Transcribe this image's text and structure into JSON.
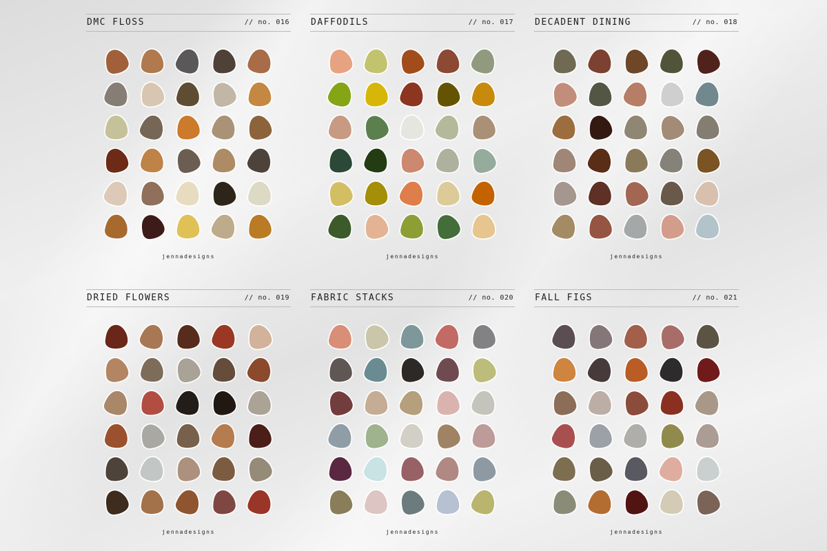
{
  "brand": "jennadesigns",
  "palettes": [
    {
      "title": "DMC FLOSS",
      "number": "// no. 016",
      "rows": [
        [
          "#a1603a",
          "#b07a4e",
          "#5a5859",
          "#4f4038",
          "#a86c48"
        ],
        [
          "#867d74",
          "#d8c6b3",
          "#5e4c33",
          "#c2b7a6",
          "#c48843"
        ],
        [
          "#c5c19a",
          "#766655",
          "#cc7a2b",
          "#a99276",
          "#8d633c"
        ],
        [
          "#6d2a16",
          "#bf8347",
          "#6b5d51",
          "#ad8c65",
          "#4e433b"
        ],
        [
          "#dcc9b7",
          "#90705a",
          "#e7dcc0",
          "#2e251a",
          "#dcd9c5"
        ],
        [
          "#a8692f",
          "#3d1b18",
          "#e0c156",
          "#bdab8b",
          "#bb7a24"
        ]
      ]
    },
    {
      "title": "DAFFODILS",
      "number": "// no. 017",
      "rows": [
        [
          "#e7a381",
          "#c2c36e",
          "#a24c1c",
          "#8c4933",
          "#919a7e"
        ],
        [
          "#86a515",
          "#d6b609",
          "#8c3520",
          "#655304",
          "#c88a0c"
        ],
        [
          "#c89a84",
          "#5b7f4d",
          "#e6e6e1",
          "#b5b99b",
          "#aa9076"
        ],
        [
          "#2c4937",
          "#233c14",
          "#cd8870",
          "#aeb19d",
          "#95ac9d"
        ],
        [
          "#d3be64",
          "#a58e08",
          "#de7e4a",
          "#dccb98",
          "#c46200"
        ],
        [
          "#3d5a2a",
          "#e3b394",
          "#8d9e35",
          "#436d39",
          "#e7c58e"
        ]
      ]
    },
    {
      "title": "DECADENT DINING",
      "number": "// no. 018",
      "rows": [
        [
          "#706a54",
          "#7c4130",
          "#6e4728",
          "#525439",
          "#4f231b"
        ],
        [
          "#c28e7b",
          "#535644",
          "#b77e67",
          "#cfcfcf",
          "#72888f"
        ],
        [
          "#9c6d3e",
          "#341912",
          "#8f8673",
          "#a28b77",
          "#847d71"
        ],
        [
          "#9f8677",
          "#5a2d17",
          "#8b7a59",
          "#858279",
          "#7a5423"
        ],
        [
          "#a5968f",
          "#5f3025",
          "#a26652",
          "#68594a",
          "#d7c0ae"
        ],
        [
          "#a58b63",
          "#965442",
          "#a4a8a8",
          "#d39d8c",
          "#b2c3c9"
        ]
      ]
    },
    {
      "title": "DRIED FLOWERS",
      "number": "// no. 019",
      "rows": [
        [
          "#6a2619",
          "#a87754",
          "#572c1d",
          "#9a3824",
          "#d2b29a"
        ],
        [
          "#b48563",
          "#7e6c5a",
          "#a8a297",
          "#654c3b",
          "#8b4a2c"
        ],
        [
          "#a98769",
          "#b24d42",
          "#221d18",
          "#211813",
          "#aaa396"
        ],
        [
          "#9b512d",
          "#a9a8a3",
          "#77604c",
          "#b57c4f",
          "#4b1e17"
        ],
        [
          "#4d433a",
          "#c2c7c6",
          "#ad907d",
          "#7c5c40",
          "#968a79"
        ],
        [
          "#3e2c1e",
          "#a3714a",
          "#8f5430",
          "#7f4742",
          "#9a3627"
        ]
      ]
    },
    {
      "title": "FABRIC STACKS",
      "number": "// no. 020",
      "rows": [
        [
          "#d98e78",
          "#c9c6a9",
          "#7e979a",
          "#c26a64",
          "#828284"
        ],
        [
          "#5f5754",
          "#6b8b92",
          "#2d2926",
          "#704a51",
          "#bcbd7a"
        ],
        [
          "#733d3d",
          "#c4ac95",
          "#b69f7d",
          "#dbb3ae",
          "#c5c4bc"
        ],
        [
          "#8f9ea6",
          "#9fb38e",
          "#d2cfc6",
          "#a08365",
          "#bd9b98"
        ],
        [
          "#5a2840",
          "#c9e3e5",
          "#976165",
          "#b08984",
          "#8d9aa3"
        ],
        [
          "#8a7d5a",
          "#ddc5c3",
          "#6b7b7e",
          "#b6c1d1",
          "#bab56e"
        ]
      ]
    },
    {
      "title": "FALL FIGS",
      "number": "// no. 021",
      "rows": [
        [
          "#5b4e52",
          "#857679",
          "#a35f49",
          "#a86d68",
          "#5b5444"
        ],
        [
          "#cf8440",
          "#473a3a",
          "#b95d25",
          "#2d2b2b",
          "#701a1b"
        ],
        [
          "#8c6d58",
          "#bdaea5",
          "#8c4c3c",
          "#8b2f20",
          "#a99888"
        ],
        [
          "#a85050",
          "#9ba1a7",
          "#b0aeab",
          "#908a4d",
          "#ab9c94"
        ],
        [
          "#7d6e50",
          "#6a5e49",
          "#595961",
          "#dfada0",
          "#cad0d0"
        ],
        [
          "#8b8c78",
          "#b46d30",
          "#511412",
          "#d4cbb6",
          "#7b6358"
        ]
      ]
    }
  ]
}
